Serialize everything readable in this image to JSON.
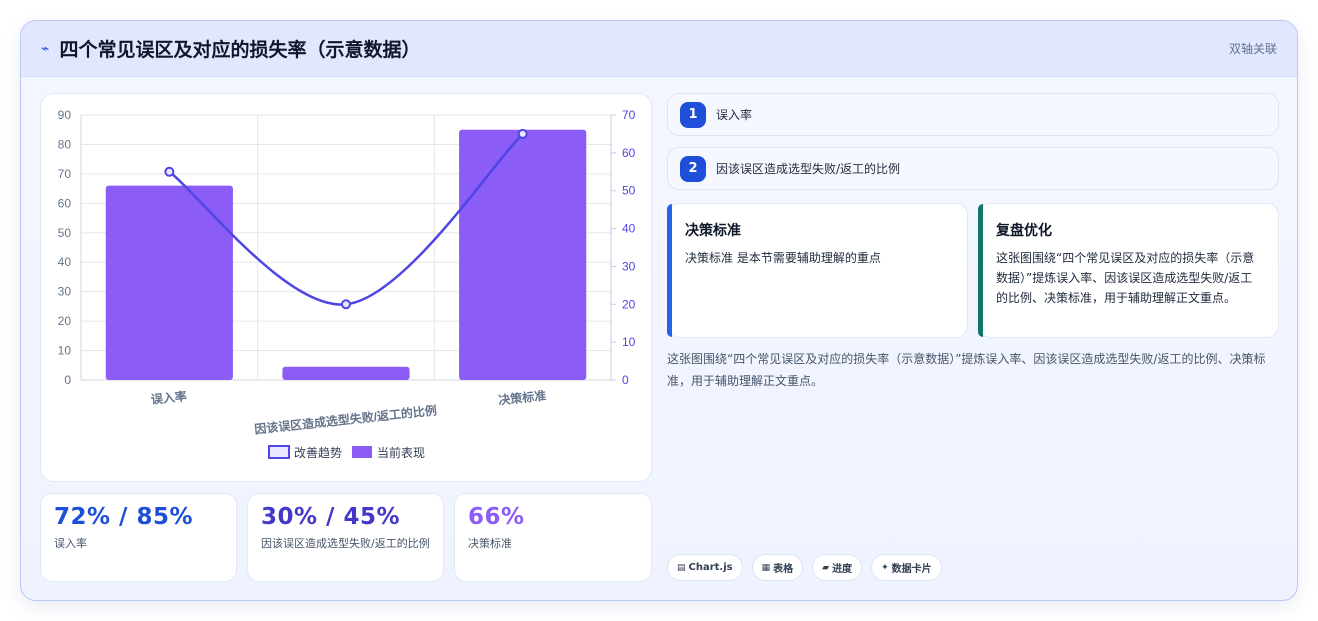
{
  "header": {
    "icon": "lightning-icon",
    "title": "四个常见误区及对应的损失率（示意数据）",
    "tag": "双轴关联"
  },
  "chart_data": {
    "type": "bar",
    "categories": [
      "误入率",
      "因该误区造成选型失败/返工的比例",
      "决策标准"
    ],
    "series": [
      {
        "name": "当前表现",
        "type": "bar",
        "axis": "left",
        "values": [
          66,
          4.5,
          85
        ],
        "color": "#8b5cf6"
      },
      {
        "name": "改善趋势",
        "type": "line",
        "axis": "right",
        "values": [
          55,
          20,
          65
        ],
        "color": "#4f46e5"
      }
    ],
    "y_left": {
      "min": 0,
      "max": 90,
      "ticks": [
        "0",
        "10",
        "20",
        "30",
        "40",
        "50",
        "60",
        "70",
        "80",
        "90"
      ]
    },
    "y_right": {
      "min": 0,
      "max": 70,
      "ticks": [
        "0",
        "10",
        "20",
        "30",
        "40",
        "50",
        "60",
        "70"
      ]
    },
    "legend": [
      "改善趋势",
      "当前表现"
    ],
    "legend_position": "bottom",
    "grid": true
  },
  "kpis": [
    {
      "value": "72% / 85%",
      "label": "误入率",
      "color": "#1d4ed8"
    },
    {
      "value": "30% / 45%",
      "label": "因该误区造成选型失败/返工的比例",
      "color": "#4338ca"
    },
    {
      "value": "66%",
      "label": "决策标准",
      "color": "#8b5cf6"
    }
  ],
  "steps": [
    {
      "num": "1",
      "text": "误入率"
    },
    {
      "num": "2",
      "text": "因该误区造成选型失败/返工的比例"
    }
  ],
  "cards": [
    {
      "title": "决策标准",
      "body": "决策标准 是本节需要辅助理解的重点",
      "accent": "#2563eb"
    },
    {
      "title": "复盘优化",
      "body": "这张图围绕“四个常见误区及对应的损失率（示意数据）”提炼误入率、因该误区造成选型失败/返工的比例、决策标准，用于辅助理解正文重点。",
      "accent": "#0f766e"
    }
  ],
  "summary": "这张图围绕“四个常见误区及对应的损失率（示意数据）”提炼误入率、因该误区造成选型失败/返工的比例、决策标准，用于辅助理解正文重点。",
  "chips": [
    {
      "icon": "▤",
      "label": "Chart.js"
    },
    {
      "icon": "▦",
      "label": "表格"
    },
    {
      "icon": "▰",
      "label": "进度"
    },
    {
      "icon": "✦",
      "label": "数据卡片"
    }
  ]
}
